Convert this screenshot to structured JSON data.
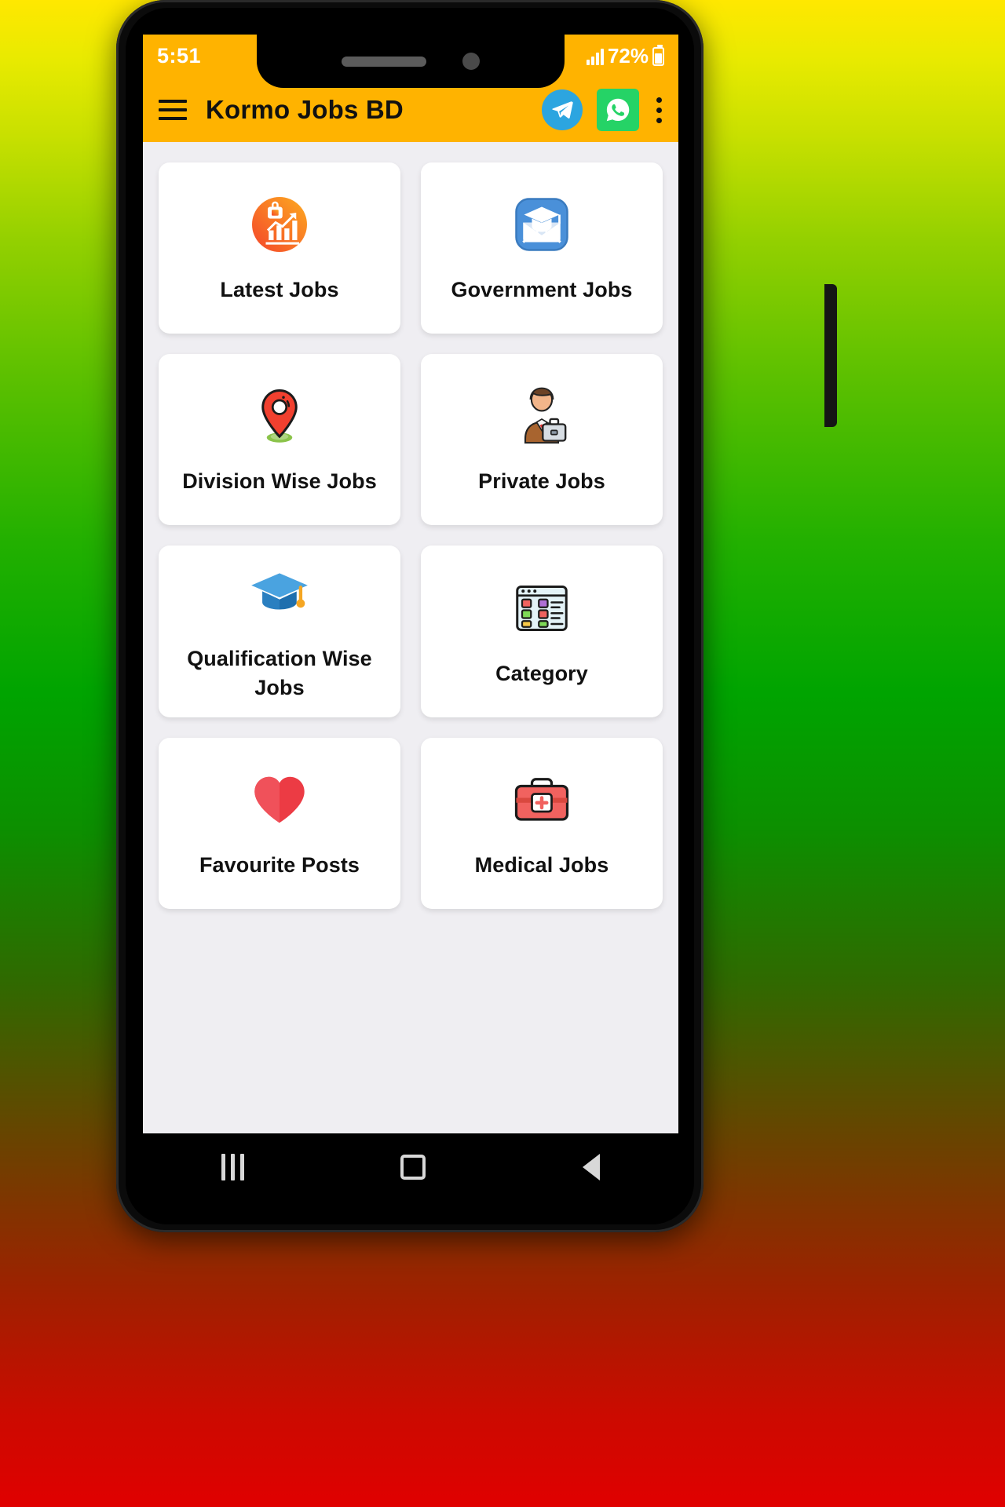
{
  "status_bar": {
    "time": "5:51",
    "battery_percent": "72%",
    "signal_icon": "signal-bars-icon",
    "battery_icon": "battery-icon"
  },
  "app_bar": {
    "menu_icon": "hamburger-menu-icon",
    "title": "Kormo Jobs BD",
    "telegram_icon": "telegram-icon",
    "whatsapp_icon": "whatsapp-icon",
    "overflow_icon": "more-vertical-icon",
    "background_color": "#ffb300"
  },
  "grid": {
    "items": [
      {
        "label": "Latest Jobs",
        "icon": "chart-growth-icon"
      },
      {
        "label": "Government Jobs",
        "icon": "graduation-envelope-icon"
      },
      {
        "label": "Division Wise Jobs",
        "icon": "map-pin-icon"
      },
      {
        "label": "Private Jobs",
        "icon": "businessman-briefcase-icon"
      },
      {
        "label": "Qualification Wise Jobs",
        "icon": "graduation-cap-icon"
      },
      {
        "label": "Category",
        "icon": "category-grid-icon"
      },
      {
        "label": "Favourite Posts",
        "icon": "heart-icon"
      },
      {
        "label": "Medical Jobs",
        "icon": "medical-kit-icon"
      }
    ]
  },
  "nav_bar": {
    "recents_icon": "recents-icon",
    "home_icon": "home-icon",
    "back_icon": "back-icon"
  },
  "colors": {
    "accent": "#ffb300",
    "page_bg": "#efeef2",
    "card_bg": "#ffffff",
    "telegram": "#2ca5e0",
    "whatsapp": "#25d366"
  }
}
